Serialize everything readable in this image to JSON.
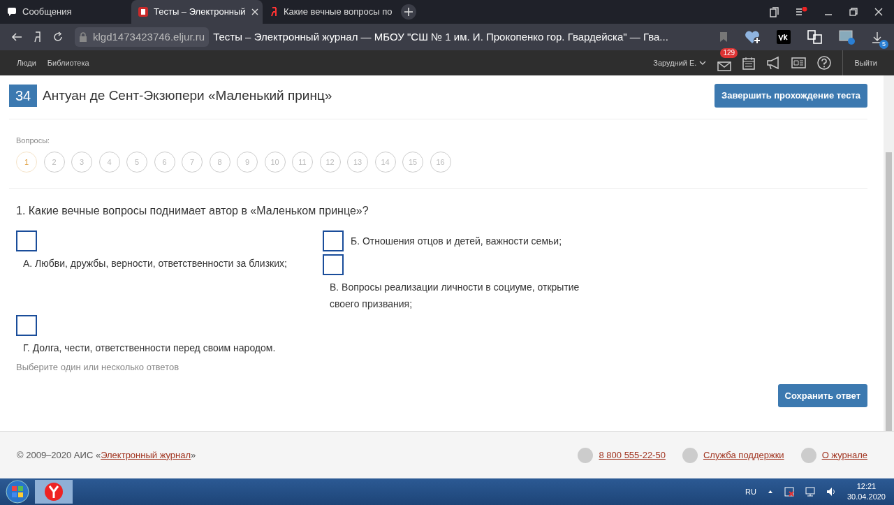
{
  "browser": {
    "tabs": [
      {
        "title": "Сообщения",
        "kind": "messages",
        "selected": false
      },
      {
        "title": "Тесты  – Электронный",
        "kind": "doc",
        "selected": true
      },
      {
        "title": "Какие вечные вопросы по",
        "kind": "yandex",
        "selected": false
      }
    ],
    "url": "klgd1473423746.eljur.ru",
    "page_title": "Тесты  – Электронный журнал — МБОУ \"СШ № 1 им. И. Прокопенко гор. Гвардейска\"  — Гва...",
    "downloads_badge": "5"
  },
  "site_nav": {
    "links": [
      "Люди",
      "Библиотека"
    ],
    "user": "Зарудний Е.",
    "mail_badge": "129",
    "logout": "Выйти"
  },
  "test": {
    "number": "34",
    "title": "Антуан де Сент-Экзюпери «Маленький принц»",
    "finish_button": "Завершить прохождение теста",
    "questions_label": "Вопросы:",
    "questions": [
      {
        "label": "1",
        "selected": true
      },
      {
        "label": "2",
        "selected": false
      },
      {
        "label": "3",
        "selected": false
      },
      {
        "label": "4",
        "selected": false
      },
      {
        "label": "5",
        "selected": false
      },
      {
        "label": "6",
        "selected": false
      },
      {
        "label": "7",
        "selected": false
      },
      {
        "label": "8",
        "selected": false
      },
      {
        "label": "9",
        "selected": false
      },
      {
        "label": "10",
        "selected": false
      },
      {
        "label": "11",
        "selected": false
      },
      {
        "label": "12",
        "selected": false
      },
      {
        "label": "13",
        "selected": false
      },
      {
        "label": "14",
        "selected": false
      },
      {
        "label": "15",
        "selected": false
      },
      {
        "label": "16",
        "selected": false
      }
    ],
    "question": "1. Какие вечные вопросы поднимает автор в «Маленьком принце»?",
    "options": [
      {
        "text": "А. Любви, дружбы, верности, ответственности за близких;",
        "kind": "stacked",
        "checked": false
      },
      {
        "text": "Б. Отношения отцов и детей, важности семьи;",
        "kind": "inline",
        "checked": false
      },
      {
        "text": "В. Вопросы реализации личности в социуме, открытие своего призвания;",
        "kind": "stacked",
        "checked": false
      },
      {
        "text": "Г. Долга, чести, ответственности перед своим народом.",
        "kind": "stacked",
        "checked": false
      }
    ],
    "hint": "Выберите один или несколько ответов",
    "save_button": "Сохранить ответ"
  },
  "footer": {
    "copyright": "© 2009–2020 АИС «",
    "journal_link": "Электронный журнал",
    "copyright_end": "»",
    "phone": "8 800 555-22-50",
    "support": "Служба поддержки",
    "about": "О журнале"
  },
  "taskbar": {
    "language": "RU",
    "time": "12:21",
    "date": "30.04.2020"
  }
}
